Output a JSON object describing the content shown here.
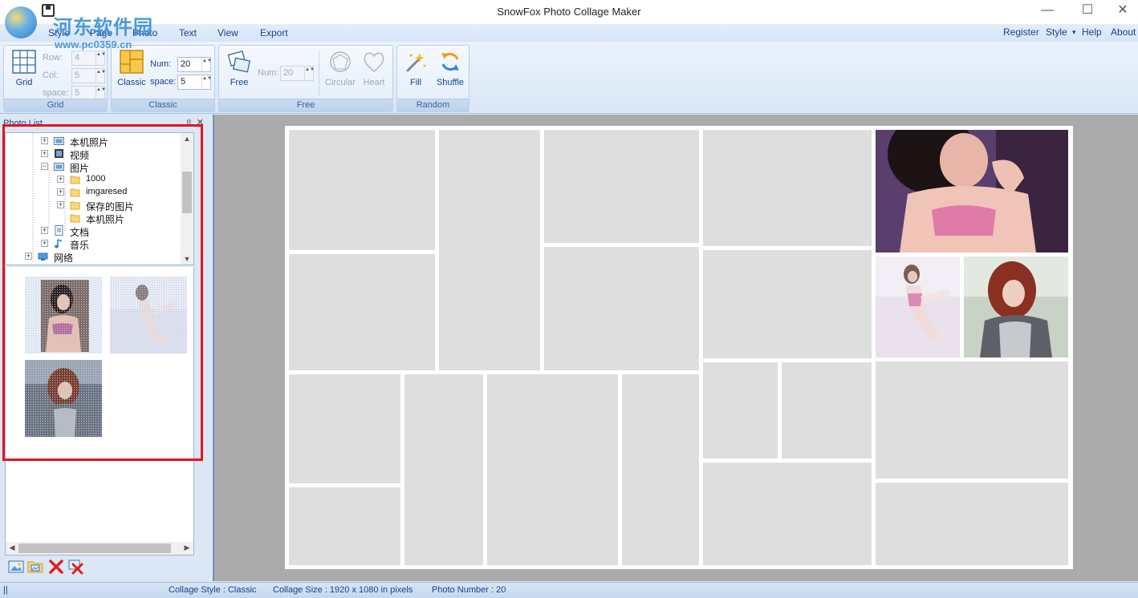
{
  "app": {
    "title": "SnowFox Photo Collage Maker"
  },
  "window_controls": {
    "minimize": "—",
    "maximize": "☐",
    "close": "✕"
  },
  "watermark": {
    "cn": "河东软件园",
    "url": "www.pc0359.cn"
  },
  "menu": {
    "items": [
      "Style",
      "Page",
      "Photo",
      "Text",
      "View",
      "Export"
    ],
    "right": [
      "Register",
      "Style",
      "Help",
      "About"
    ],
    "style_caret": "▾"
  },
  "ribbon": {
    "grid": {
      "group_label": "Grid",
      "button": "Grid",
      "row_label": "Row:",
      "row_value": "4",
      "col_label": "Col:",
      "col_value": "5",
      "space_label": "space:",
      "space_value": "5"
    },
    "classic": {
      "group_label": "Classic",
      "button": "Classic",
      "num_label": "Num:",
      "num_value": "20",
      "space_label": "space:",
      "space_value": "5"
    },
    "free": {
      "group_label": "Free",
      "button": "Free",
      "num_label": "Num:",
      "num_value": "20",
      "circular": "Circular",
      "heart": "Heart"
    },
    "random": {
      "group_label": "Random",
      "fill": "Fill",
      "shuffle": "Shuffle"
    },
    "spin_arrows": "▲▼"
  },
  "photo_list": {
    "title": "Photo List",
    "pin": "ᴨ",
    "close": "✕",
    "tree": [
      {
        "label": "本机照片",
        "exp": "+"
      },
      {
        "label": "视频",
        "exp": "+"
      },
      {
        "label": "图片",
        "exp": "−"
      },
      {
        "label": "1000",
        "exp": "+"
      },
      {
        "label": "imgaresed",
        "exp": "+"
      },
      {
        "label": "保存的图片",
        "exp": "+"
      },
      {
        "label": "本机照片",
        "exp": ""
      },
      {
        "label": "文档",
        "exp": "+"
      },
      {
        "label": "音乐",
        "exp": "+"
      },
      {
        "label": "网络",
        "exp": "+"
      }
    ],
    "scroll_up": "▲",
    "scroll_down": "▼",
    "scroll_left": "◀",
    "scroll_right": "▶"
  },
  "status": {
    "separator": "||",
    "collage_style": "Collage Style : Classic",
    "collage_size": "Collage Size : 1920 x 1080  in pixels",
    "photo_number": "Photo Number : 20"
  },
  "colors": {
    "accent": "#15428b",
    "highlight_box": "#e3141e",
    "workspace": "#ababab",
    "cell": "#dedede"
  },
  "icons": [
    "grid-icon",
    "classic-icon",
    "free-icon",
    "circular-icon",
    "heart-icon",
    "fill-wand-icon",
    "shuffle-icon",
    "add-photo-icon",
    "add-folder-icon",
    "delete-icon",
    "delete-all-icon"
  ]
}
